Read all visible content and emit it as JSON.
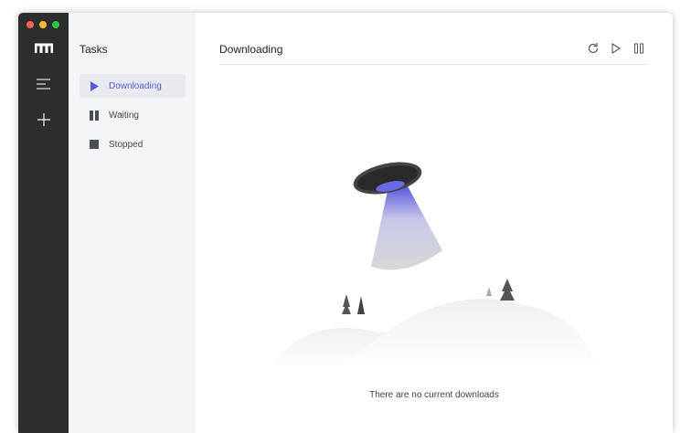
{
  "sidebar": {
    "icons": [
      "logo-icon",
      "menu-icon",
      "add-icon"
    ]
  },
  "tasks": {
    "title": "Tasks",
    "items": [
      {
        "label": "Downloading",
        "icon": "play-icon",
        "active": true
      },
      {
        "label": "Waiting",
        "icon": "pause-icon"
      },
      {
        "label": "Stopped",
        "icon": "stop-icon"
      }
    ]
  },
  "main": {
    "title": "Downloading",
    "toolbar": [
      "refresh-icon",
      "play-icon",
      "pause-icon"
    ],
    "empty_text": "There are no current downloads"
  },
  "colors": {
    "accent": "#5b5bd6",
    "sidebar": "#2d2d2d"
  }
}
